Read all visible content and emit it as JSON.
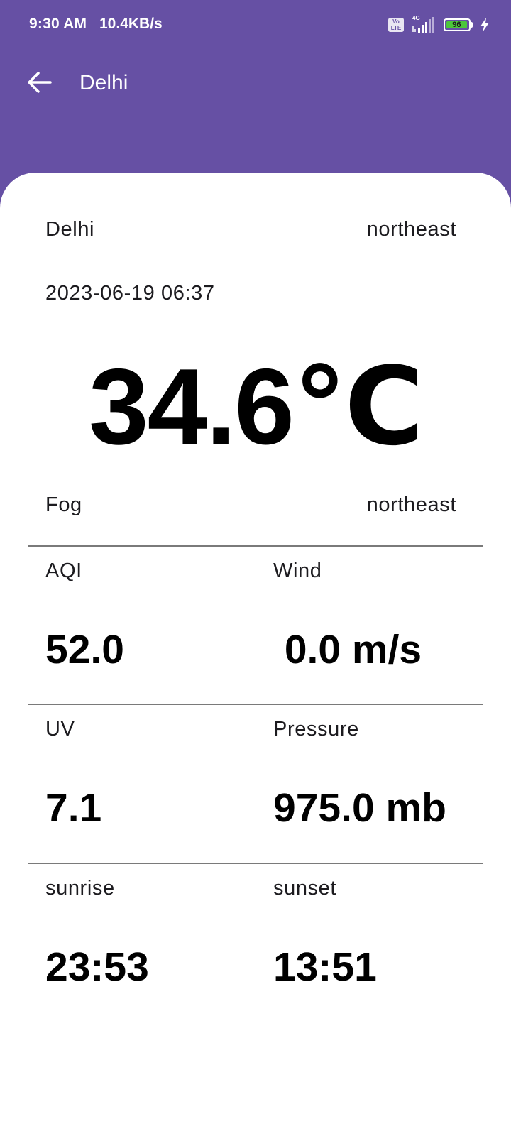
{
  "status_bar": {
    "time": "9:30 AM",
    "net_speed": "10.4KB/s",
    "volte_label": "Vo\nLTE",
    "network_type": "4G",
    "battery_level": "96",
    "battery_percent": 96,
    "icons": [
      "volte-icon",
      "signal-icon",
      "battery-icon",
      "charging-icon"
    ]
  },
  "toolbar": {
    "title": "Delhi",
    "back_icon": "arrow-left-icon"
  },
  "weather": {
    "city": "Delhi",
    "wind_direction_top": "northeast",
    "timestamp": "2023-06-19 06:37",
    "temperature": "34.6℃",
    "condition": "Fog",
    "wind_direction": "northeast"
  },
  "metrics": {
    "aqi_label": "AQI",
    "aqi_value": "52.0",
    "wind_label": "Wind",
    "wind_value": " 0.0 m/s",
    "uv_label": "UV",
    "uv_value": "7.1",
    "pressure_label": "Pressure",
    "pressure_value": "975.0 mb",
    "sunrise_label": "sunrise",
    "sunrise_value": "23:53",
    "sunset_label": "sunset",
    "sunset_value": "13:51"
  },
  "colors": {
    "primary": "#6650a4",
    "background": "#ffffff",
    "battery_fill": "#4cc73a"
  }
}
